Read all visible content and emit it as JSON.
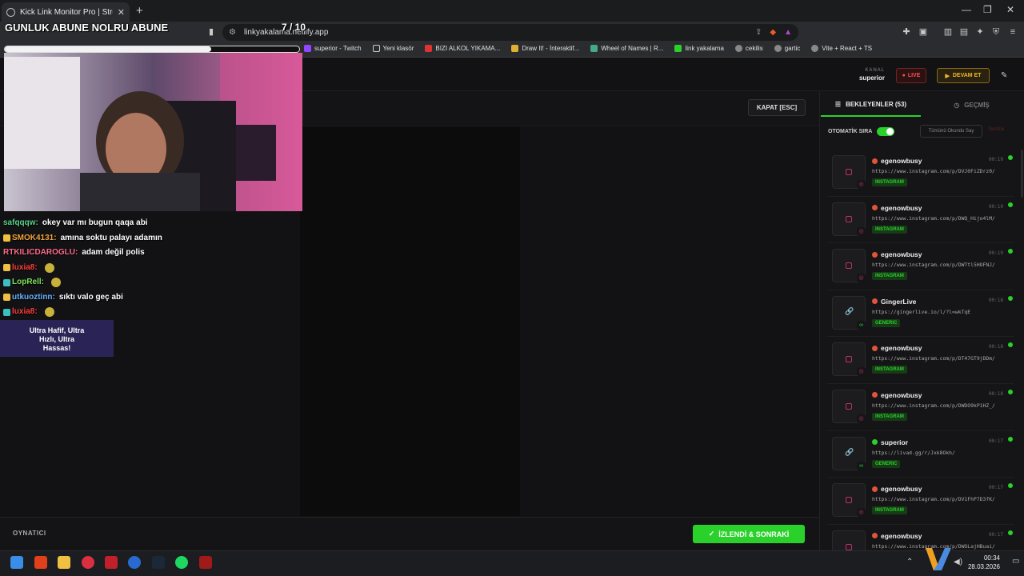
{
  "browser": {
    "tab_title": "Kick Link Monitor Pro | Stream D",
    "url": "linkyakalama.netlify.app",
    "bookmarks": [
      "superior - Twitch",
      "Yeni klasör",
      "BIZI ALKOL YIKAMA...",
      "Draw It! - İnteraktif...",
      "Wheel of Names | R...",
      "link yakalama",
      "cekilis",
      "gartic",
      "Vite + React + TS"
    ]
  },
  "overlay": {
    "title": "GUNLUK ABUNE NOLRU ABUNE",
    "count": "7 / 10",
    "progress": 0.7,
    "ad_text": "Ultra Hafif, Ultra Hızlı, Ultra Hassas!"
  },
  "chat": [
    {
      "user": "safqqqw:",
      "msg": "okey var mı bugun qaqa abi",
      "color": "#56d18a",
      "emote": false
    },
    {
      "user": "SMOK4131:",
      "msg": "amına soktu palayı adamın",
      "color": "#f0a23a",
      "emote": false
    },
    {
      "user": "RTKILICDAROGLU:",
      "msg": "adam değil polis",
      "color": "#ff6a8a",
      "emote": false
    },
    {
      "user": "luxia8:",
      "msg": "",
      "color": "#ff3d3d",
      "emote": true
    },
    {
      "user": "LopRell:",
      "msg": "",
      "color": "#7ee05a",
      "emote": true
    },
    {
      "user": "utkuoztinn:",
      "msg": "sıktı valo geç abi",
      "color": "#6ab0ff",
      "emote": false
    },
    {
      "user": "luxia8:",
      "msg": "",
      "color": "#ff3d3d",
      "emote": true
    }
  ],
  "header": {
    "kanal_label": "KANAL",
    "kanal_value": "superior",
    "live_label": "LIVE",
    "devam_label": "DEVAM ET"
  },
  "player": {
    "close_label": "KAPAT [ESC]",
    "footer_label": "OYNATICI",
    "next_label": "İZLENDİ & SONRAKİ"
  },
  "queue": {
    "tab_waiting": "BEKLEYENLER (53)",
    "tab_history": "GEÇMİŞ",
    "auto_label": "OTOMATİK SIRA",
    "mark_read": "Tümünü Okundu Say",
    "clear": "Temizle",
    "items": [
      {
        "user": "egenowbusy",
        "url": "https://www.instagram.com/p/DVJ0FiZDrz0/",
        "tag": "INSTAGRAM",
        "time": "00:19",
        "kind": "ig"
      },
      {
        "user": "egenowbusy",
        "url": "https://www.instagram.com/p/DWQ_Hijo4lM/",
        "tag": "INSTAGRAM",
        "time": "00:19",
        "kind": "ig"
      },
      {
        "user": "egenowbusy",
        "url": "https://www.instagram.com/p/DWTtl5HOFNJ/",
        "tag": "INSTAGRAM",
        "time": "00:19",
        "kind": "ig"
      },
      {
        "user": "GingerLive",
        "url": "https://gingerlive.io/l/?l=wkTqE",
        "tag": "GENERIC",
        "time": "00:18",
        "kind": "link"
      },
      {
        "user": "egenowbusy",
        "url": "https://www.instagram.com/p/DT47GT9jDDm/",
        "tag": "INSTAGRAM",
        "time": "00:18",
        "kind": "ig"
      },
      {
        "user": "egenowbusy",
        "url": "https://www.instagram.com/p/DWDO9kP1HZ_/",
        "tag": "INSTAGRAM",
        "time": "00:18",
        "kind": "ig"
      },
      {
        "user": "superior",
        "url": "https://livad.gg/r/Jxk8Okh/",
        "tag": "GENERIC",
        "time": "00:17",
        "kind": "link"
      },
      {
        "user": "egenowbusy",
        "url": "https://www.instagram.com/p/DV1FhP7D3fK/",
        "tag": "INSTAGRAM",
        "time": "00:17",
        "kind": "ig"
      },
      {
        "user": "egenowbusy",
        "url": "https://www.instagram.com/p/DWOLajHBuai/",
        "tag": "INSTAGRAM",
        "time": "00:17",
        "kind": "ig"
      }
    ]
  },
  "taskbar": {
    "time": "00:34",
    "date": "28.03.2026"
  }
}
